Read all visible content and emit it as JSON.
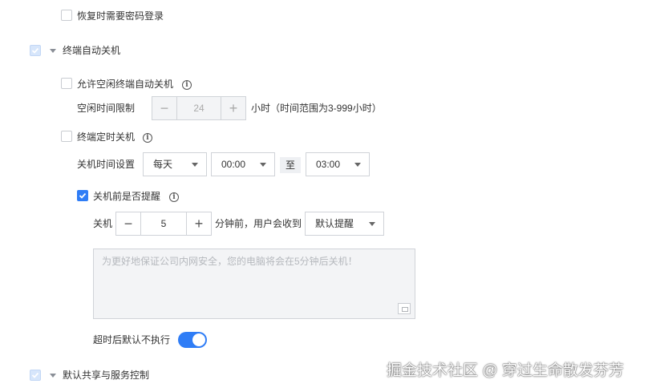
{
  "restore_password": {
    "label": "恢复时需要密码登录",
    "checked": false
  },
  "auto_shutdown_section": {
    "label": "终端自动关机",
    "checked": true
  },
  "allow_idle_shutdown": {
    "label": "允许空闲终端自动关机",
    "checked": false
  },
  "idle_time": {
    "label": "空闲时间限制",
    "value": "24",
    "unit_hint": "小时（时间范围为3-999小时）",
    "minus": "−",
    "plus": "+"
  },
  "scheduled_shutdown": {
    "label": "终端定时关机",
    "checked": false
  },
  "shutdown_time": {
    "label": "关机时间设置",
    "frequency": "每天",
    "start": "00:00",
    "to": "至",
    "end": "03:00"
  },
  "remind_before": {
    "label": "关机前是否提醒",
    "checked": true
  },
  "remind": {
    "prefix": "关机",
    "minutes": "5",
    "suffix": "分钟前，用户会收到",
    "type": "默认提醒",
    "minus": "−",
    "plus": "+"
  },
  "message": {
    "placeholder": "为更好地保证公司内网安全，您的电脑将会在5分钟后关机！"
  },
  "timeout": {
    "label": "超时后默认不执行",
    "on": true
  },
  "share_section": {
    "label": "默认共享与服务控制",
    "checked": true
  },
  "watermark": "掘金技术社区 @ 穿过生命散发芬芳",
  "colors": {
    "accent": "#2f7df6",
    "border": "#d0d3d8",
    "text": "#333333"
  }
}
